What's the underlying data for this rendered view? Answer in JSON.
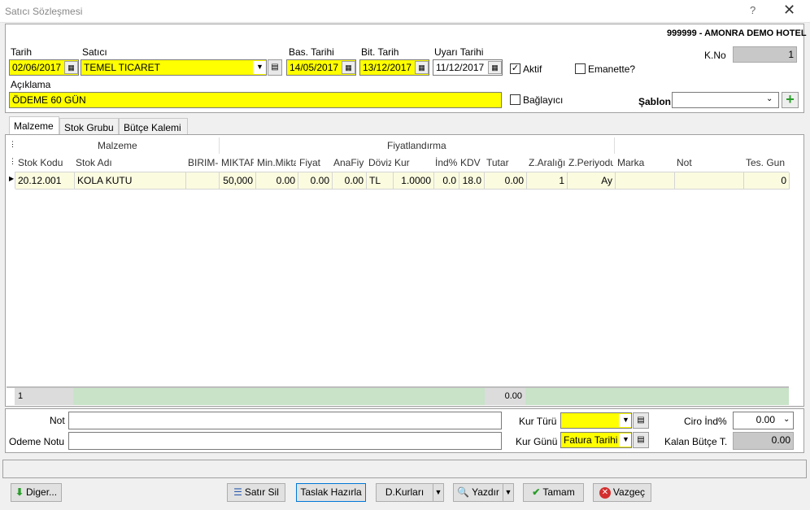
{
  "window": {
    "title": "Satıcı Sözleşmesi",
    "help": "?",
    "close": "✕"
  },
  "company": "999999 - AMONRA DEMO HOTEL",
  "header": {
    "tarih_label": "Tarih",
    "tarih_value": "02/06/2017",
    "satici_label": "Satıcı",
    "satici_value": "TEMEL TICARET",
    "bas_label": "Bas. Tarihi",
    "bas_value": "14/05/2017",
    "bit_label": "Bit. Tarih",
    "bit_value": "13/12/2017",
    "uyari_label": "Uyarı Tarihi",
    "uyari_value": "11/12/2017",
    "aktif_label": "Aktif",
    "emanette_label": "Emanette?",
    "kno_label": "K.No",
    "kno_value": "1",
    "aciklama_label": "Açıklama",
    "aciklama_value": "ÖDEME 60 GÜN",
    "baglayici_label": "Bağlayıcı",
    "sablon_label": "Şablon",
    "sablon_value": ""
  },
  "tabs": [
    "Malzeme",
    "Stok Grubu",
    "Bütçe Kalemi"
  ],
  "grid": {
    "band_malzeme": "Malzeme",
    "band_fiyat": "Fiyatlandırma",
    "columns": [
      "Stok Kodu",
      "Stok Adı",
      "BIRIM-",
      "MIKTAR",
      "Min.Mikta",
      "Fiyat",
      "AnaFiy",
      "Döviz",
      "Kur",
      "İnd%",
      "KDV",
      "Tutar",
      "Z.Aralığı",
      "Z.Periyodu",
      "Marka",
      "Not",
      "Tes. Gun"
    ],
    "rows": [
      [
        "20.12.001",
        "KOLA KUTU",
        "",
        "50,000",
        "0.00",
        "0.00",
        "0.00",
        "TL",
        "1.0000",
        "0.0",
        "18.0",
        "0.00",
        "1",
        "Ay",
        "",
        "",
        "0"
      ]
    ],
    "footer_count": "1",
    "footer_total": "0.00"
  },
  "bottom": {
    "not_label": "Not",
    "not_value": "",
    "odeme_label": "Odeme Notu",
    "odeme_value": "",
    "kurturu_label": "Kur Türü",
    "kurturu_value": "",
    "kurgunu_label": "Kur Günü",
    "kurgunu_value": "Fatura Tarihi",
    "ciro_label": "Ciro İnd%",
    "ciro_value": "0.00",
    "kalan_label": "Kalan Bütçe T.",
    "kalan_value": "0.00"
  },
  "buttons": {
    "diger": "Diger...",
    "satirsil": "Satır Sil",
    "taslak": "Taslak Hazırla",
    "dkurlari": "D.Kurları",
    "yazdir": "Yazdır",
    "tamam": "Tamam",
    "vazgec": "Vazgeç"
  },
  "colors": {
    "yellow": "#ffff00",
    "gridfooter": "#c8e3c8"
  }
}
